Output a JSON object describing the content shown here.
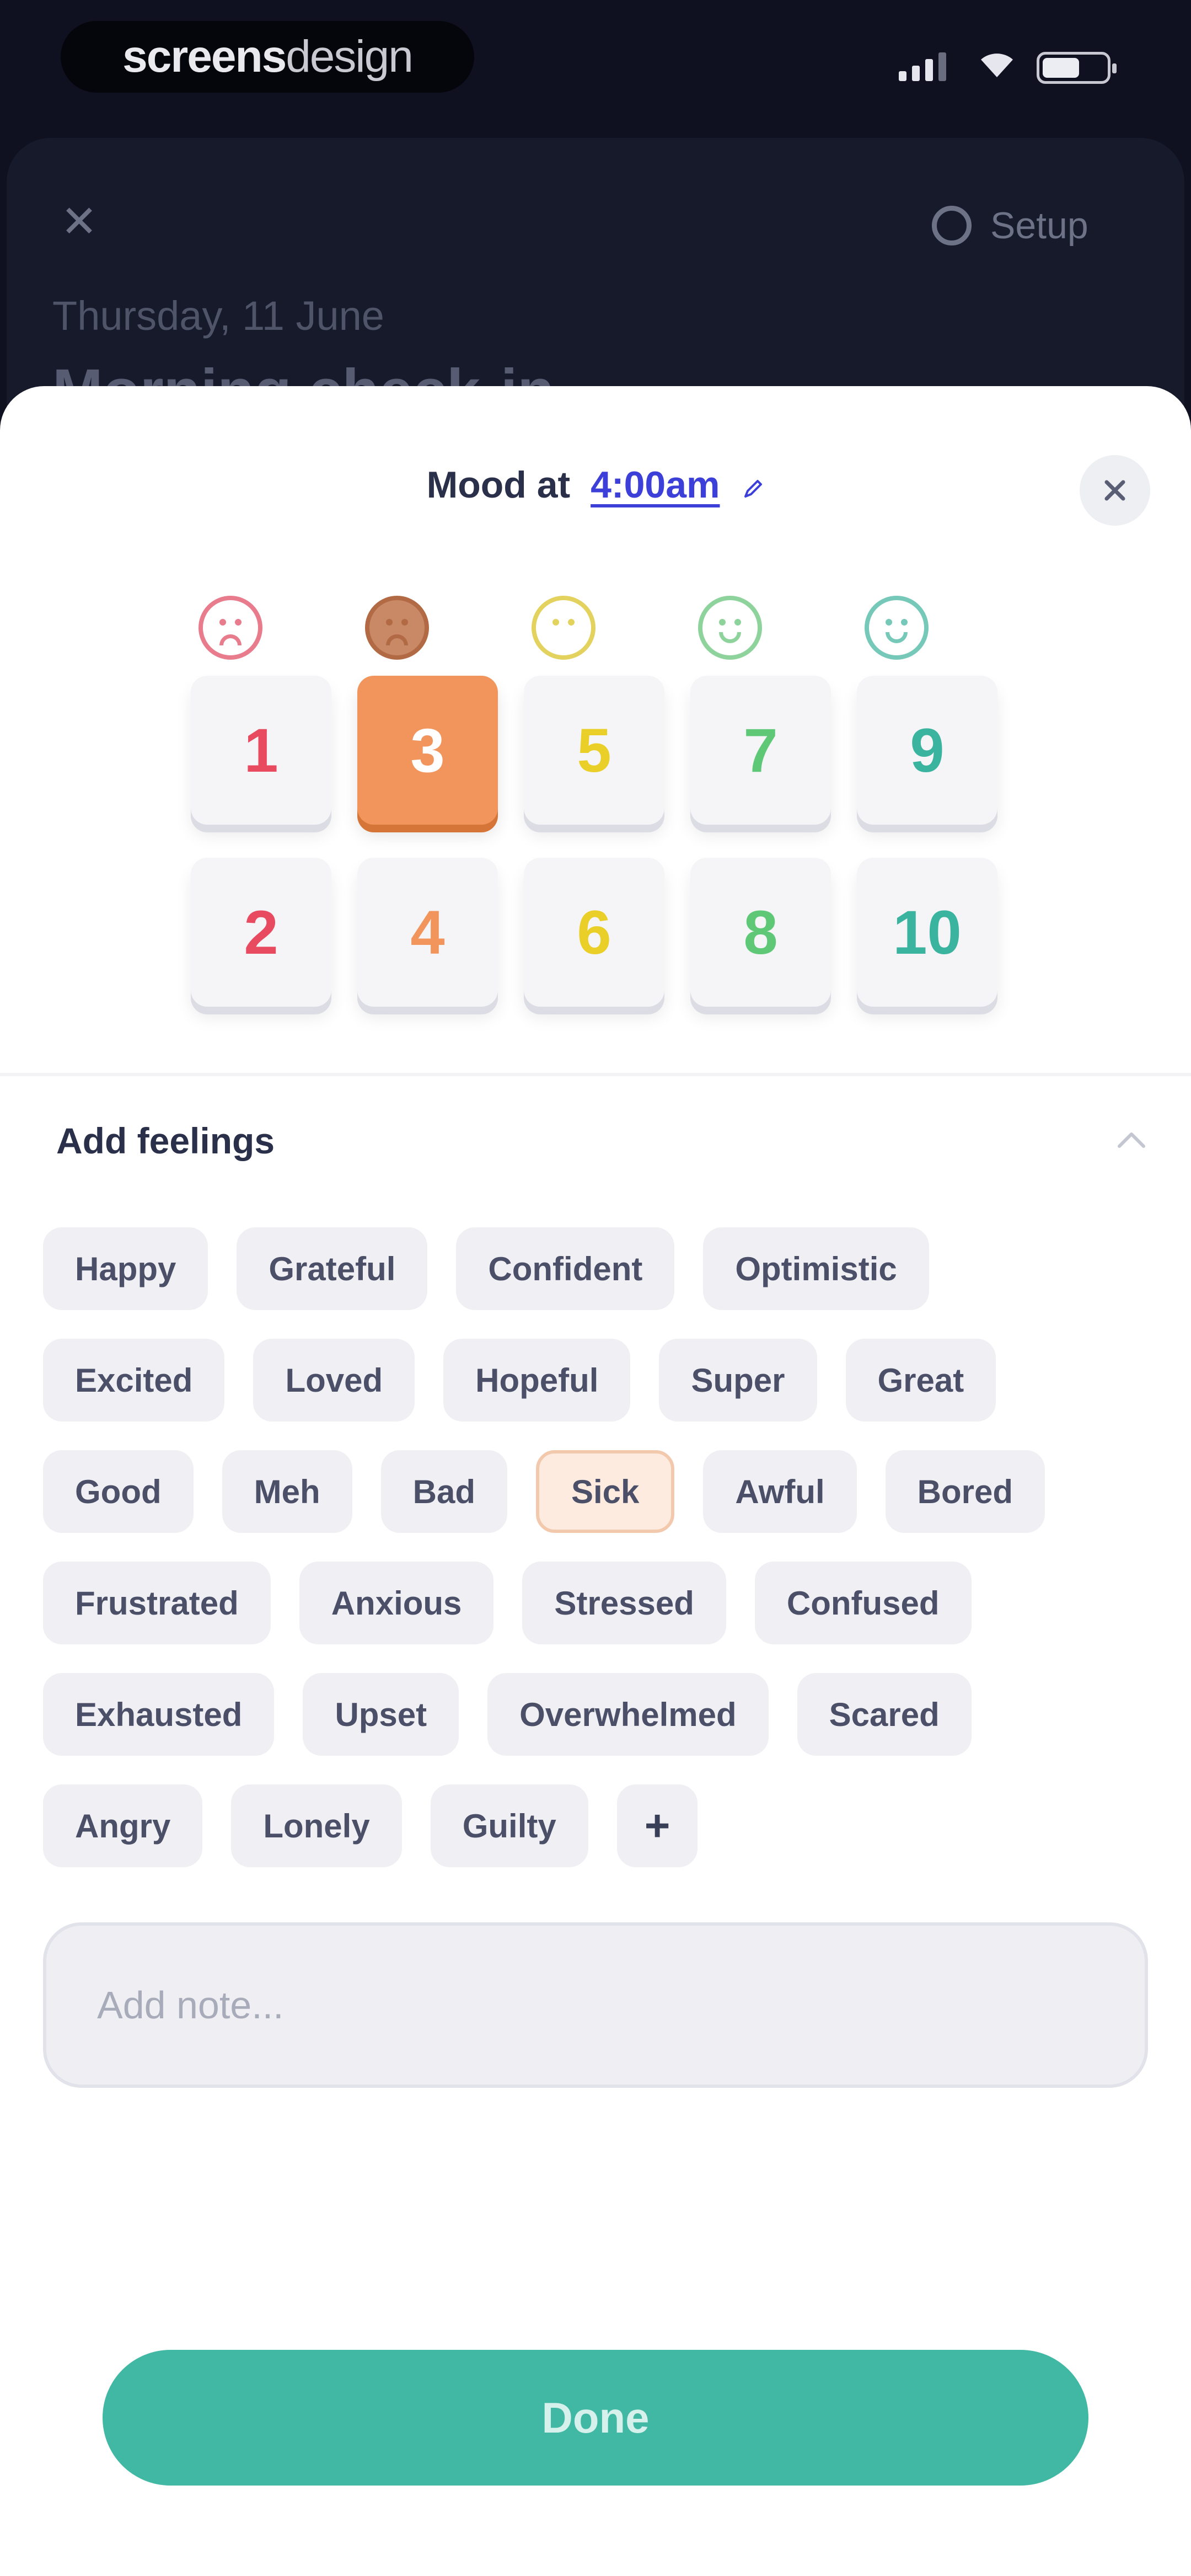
{
  "status_bar": {
    "brand_bold": "screens",
    "brand_light": "design",
    "icons": [
      "signal-icon",
      "wifi-icon",
      "battery-icon"
    ]
  },
  "background": {
    "close_glyph": "✕",
    "setup_label": "Setup",
    "date": "Thursday, 11 June",
    "title": "Morning check-in"
  },
  "sheet": {
    "title_prefix": "Mood at",
    "time": "4:00am",
    "close_glyph": "✕",
    "selected_score": 3,
    "scale_row_1": [
      "1",
      "3",
      "5",
      "7",
      "9"
    ],
    "scale_row_2": [
      "2",
      "4",
      "6",
      "8",
      "10"
    ],
    "scale_colors": {
      "1": "#e84a5f",
      "2": "#e84a5f",
      "3": "#f1955c",
      "4": "#f1955c",
      "5": "#e9cf28",
      "6": "#e9cf28",
      "7": "#5ec877",
      "8": "#5ec877",
      "9": "#3ab39f",
      "10": "#3ab39f"
    },
    "faces": [
      {
        "mood": "awful",
        "color": "#e87c8c"
      },
      {
        "mood": "bad",
        "color": "#b26a45"
      },
      {
        "mood": "okay",
        "color": "#e3d25e"
      },
      {
        "mood": "good",
        "color": "#8fd39c"
      },
      {
        "mood": "great",
        "color": "#76c8b8"
      }
    ],
    "feelings": {
      "title": "Add feelings",
      "rows": [
        [
          "Happy",
          "Grateful",
          "Confident",
          "Optimistic"
        ],
        [
          "Excited",
          "Loved",
          "Hopeful",
          "Super",
          "Great"
        ],
        [
          "Good",
          "Meh",
          "Bad",
          "Sick",
          "Awful",
          "Bored"
        ],
        [
          "Frustrated",
          "Anxious",
          "Stressed",
          "Confused"
        ],
        [
          "Exhausted",
          "Upset",
          "Overwhelmed",
          "Scared"
        ],
        [
          "Angry",
          "Lonely",
          "Guilty"
        ]
      ],
      "selected": [
        "Sick"
      ],
      "add_glyph": "+"
    },
    "note_placeholder": "Add note...",
    "done_label": "Done"
  }
}
